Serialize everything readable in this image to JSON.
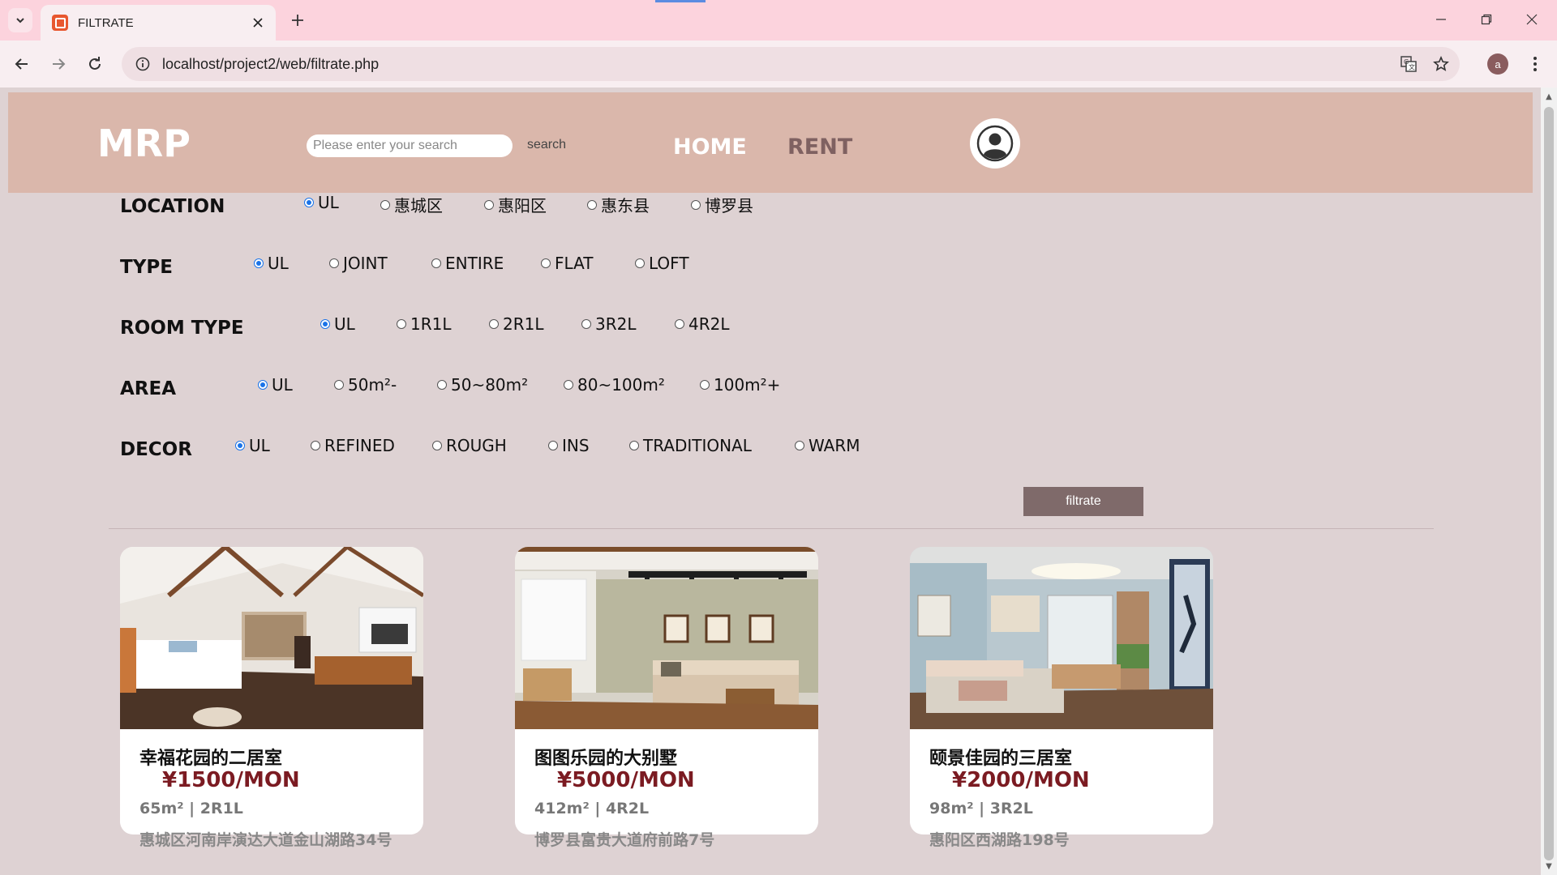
{
  "browser": {
    "tab_title": "FILTRATE",
    "url": "localhost/project2/web/filtrate.php",
    "profile_initial": "a"
  },
  "header": {
    "logo": "MRP",
    "search_placeholder": "Please enter your search",
    "search_label": "search",
    "nav_home": "HOME",
    "nav_rent": "RENT",
    "home_color": "#ffffff",
    "rent_color": "#7f6161"
  },
  "filters": {
    "location": {
      "label": "LOCATION",
      "options": [
        "UL",
        "惠城区",
        "惠阳区",
        "惠东县",
        "博罗县"
      ],
      "selected": "UL"
    },
    "type": {
      "label": "TYPE",
      "options": [
        "UL",
        "JOINT",
        "ENTIRE",
        "FLAT",
        "LOFT"
      ],
      "selected": "UL"
    },
    "room_type": {
      "label": "ROOM TYPE",
      "options": [
        "UL",
        "1R1L",
        "2R1L",
        "3R2L",
        "4R2L"
      ],
      "selected": "UL"
    },
    "area": {
      "label": "AREA",
      "options": [
        "UL",
        "50m²-",
        "50~80m²",
        "80~100m²",
        "100m²+"
      ],
      "selected": "UL"
    },
    "decor": {
      "label": "DECOR",
      "options": [
        "UL",
        "REFINED",
        "ROUGH",
        "INS",
        "TRADITIONAL",
        "WARM"
      ],
      "selected": "UL"
    },
    "submit_label": "filtrate"
  },
  "listings": [
    {
      "title": "幸福花园的二居室",
      "price": "¥1500/MON",
      "spec": "65m² | 2R1L",
      "address": "惠城区河南岸演达大道金山湖路34号"
    },
    {
      "title": "图图乐园的大别墅",
      "price": "¥5000/MON",
      "spec": "412m² | 4R2L",
      "address": "博罗县富贵大道府前路7号"
    },
    {
      "title": "颐景佳园的三居室",
      "price": "¥2000/MON",
      "spec": "98m² | 3R2L",
      "address": "惠阳区西湖路198号"
    }
  ],
  "colors": {
    "accent_selected": "#1a73e8",
    "header_bg": "#dab7ab",
    "page_bg": "#ded2d3",
    "price": "#7b1b22",
    "button_bg": "#7f6a6a"
  }
}
